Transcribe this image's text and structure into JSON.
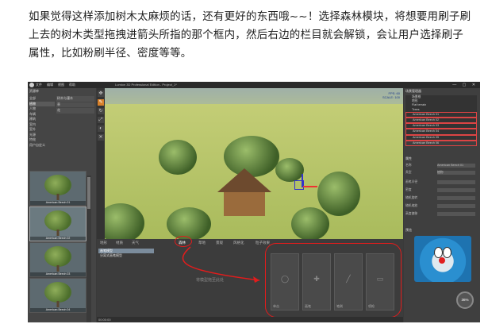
{
  "article": {
    "line1": "如果觉得这样添加树木太麻烦的话，还有更好的东西哦~~！选择森林模块，将想要用刷子刷",
    "line2": "上去的树木类型拖拽进箭头所指的那个框内，然后右边的栏目就会解锁，会让用户选择刷子",
    "line3": "属性，比如粉刷半径、密度等等。"
  },
  "app": {
    "window_title": "Lumion 3D Professional Edition - Project_1*",
    "menu": [
      "文件",
      "编辑",
      "视图",
      "帮助"
    ],
    "left_panel": {
      "tab": "资源库",
      "categories": [
        "全部",
        "植物",
        "人物",
        "车辆",
        "建筑",
        "室内",
        "室外",
        "光源",
        "特效",
        "用户自定义"
      ],
      "subcategories": [
        "树木与灌木",
        "草",
        "花"
      ],
      "thumbnails": [
        {
          "caption": "American Beech 01",
          "selected": false
        },
        {
          "caption": "American Beech 02",
          "selected": true
        },
        {
          "caption": "American Beech 03",
          "selected": false
        },
        {
          "caption": "American Beech 04",
          "selected": false
        }
      ]
    },
    "tools": [
      "move",
      "brush",
      "rotate",
      "scale",
      "paint",
      "delete"
    ],
    "viewport": {
      "fps": "FPS: 60",
      "scale": "SCALE: 100"
    },
    "bottom_panel": {
      "tabs": [
        "地形",
        "材质",
        "天气",
        "森林",
        "草地",
        "景观",
        "风格化",
        "粒子效果"
      ],
      "active_tab": "森林",
      "list": [
        "画笔模型",
        "分离式画笔模型"
      ],
      "selected_list": "画笔模型",
      "drop_hint": "将模型拖至此处",
      "slots": [
        {
          "label": "单击",
          "icon": "◯"
        },
        {
          "label": "画笔",
          "icon": "✚"
        },
        {
          "label": "笔刷",
          "icon": "╱"
        },
        {
          "label": "喷枪",
          "icon": "▭"
        }
      ]
    },
    "status": "00:00:00",
    "right_panel": {
      "header": "场景管理器",
      "layers": [
        "场景根",
        "地形",
        "Flat terrain",
        "Trees",
        "American Beech 01",
        "American Beech 02",
        "American Beech 03",
        "American Beech 04",
        "American Beech 05",
        "American Beech 06"
      ],
      "properties_title": "属性",
      "props": [
        {
          "label": "名称",
          "value": "American Beech 01"
        },
        {
          "label": "类型",
          "value": "植物"
        },
        {
          "label": "画笔半径",
          "value": ""
        },
        {
          "label": "密度",
          "value": ""
        },
        {
          "label": "随机旋转",
          "value": ""
        },
        {
          "label": "随机缩放",
          "value": ""
        },
        {
          "label": "高度偏移",
          "value": ""
        }
      ],
      "preview_title": "预览",
      "gauge": "36%"
    }
  },
  "colors": {
    "annotation_red": "#e21c1c",
    "accent_orange": "#d8812a",
    "panel_dark": "#3c3c3c"
  }
}
